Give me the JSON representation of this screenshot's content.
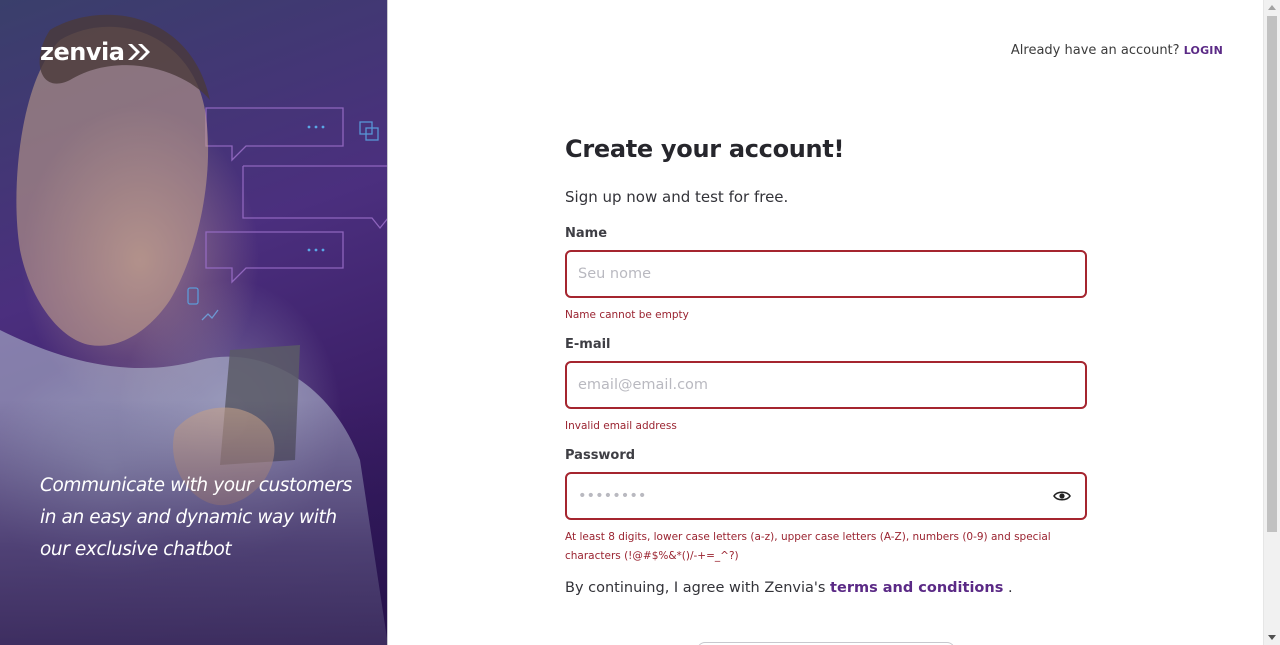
{
  "brand": {
    "logo_text": "zenvia",
    "logo_icon": "double-chevron-icon"
  },
  "hero": {
    "caption_lines": [
      "Communicate with your customers",
      "in an easy and dynamic way with",
      "our exclusive chatbot"
    ]
  },
  "header": {
    "account_prompt": "Already have an account?",
    "login_label": "LOGIN"
  },
  "form": {
    "title": "Create your account!",
    "subtitle": "Sign up now and test for free.",
    "name": {
      "label": "Name",
      "placeholder": "Seu nome",
      "value": "",
      "error": "Name cannot be empty"
    },
    "email": {
      "label": "E-mail",
      "placeholder": "email@email.com",
      "value": "",
      "error": "Invalid email address"
    },
    "password": {
      "label": "Password",
      "placeholder": "••••••••",
      "value": "",
      "toggle_icon": "eye-icon",
      "error_line1": "At least 8 digits, lower case letters (a-z), upper case letters (A-Z), numbers (0-9) and special",
      "error_line2": "characters (!@#$%&*()/-+=_^?)"
    },
    "terms": {
      "prefix": "By continuing, I agree with Zenvia's ",
      "link": "terms and conditions",
      "suffix": " ."
    }
  },
  "colors": {
    "brand_purple": "#5b2a86",
    "error_red": "#a5252f",
    "text_dark": "#26262c"
  }
}
